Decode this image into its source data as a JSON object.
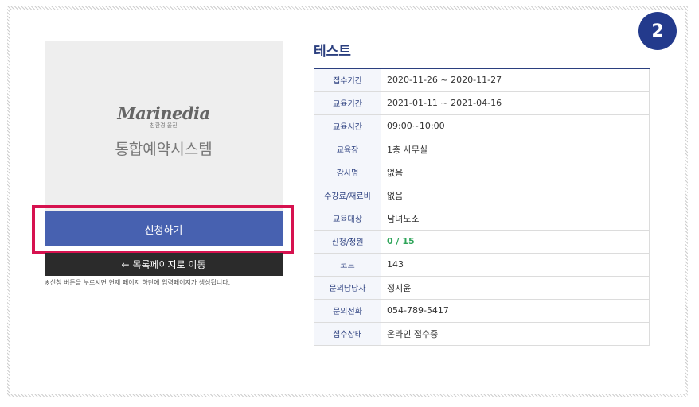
{
  "step": {
    "number": "2"
  },
  "poster": {
    "logo_text": "Marinedia",
    "logo_subtext": "친환경 울진",
    "title": "통합예약시스템"
  },
  "buttons": {
    "apply_label": "신청하기",
    "back_label": "← 목록페이지로 이동"
  },
  "note": "※신청 버튼을 누르시면 현재 페이지 하단에 입력페이지가 생성됩니다.",
  "course": {
    "title": "테스트",
    "rows": [
      {
        "label": "접수기간",
        "value": "2020-11-26 ~ 2020-11-27"
      },
      {
        "label": "교육기간",
        "value": "2021-01-11 ~ 2021-04-16"
      },
      {
        "label": "교육시간",
        "value": "09:00~10:00"
      },
      {
        "label": "교육장",
        "value": "1층 사무실"
      },
      {
        "label": "강사명",
        "value": "없음"
      },
      {
        "label": "수강료/재료비",
        "value": "없음"
      },
      {
        "label": "교육대상",
        "value": "남녀노소"
      },
      {
        "label": "신청/정원",
        "value": "0 / 15"
      },
      {
        "label": "코드",
        "value": "143"
      },
      {
        "label": "문의담당자",
        "value": "정지윤"
      },
      {
        "label": "문의전화",
        "value": "054-789-5417"
      },
      {
        "label": "접수상태",
        "value": "온라인 접수중"
      }
    ]
  },
  "colors": {
    "accent": "#233a8c",
    "apply_button": "#4761b0",
    "highlight": "#d6124f",
    "quota_green": "#2fa55a"
  }
}
